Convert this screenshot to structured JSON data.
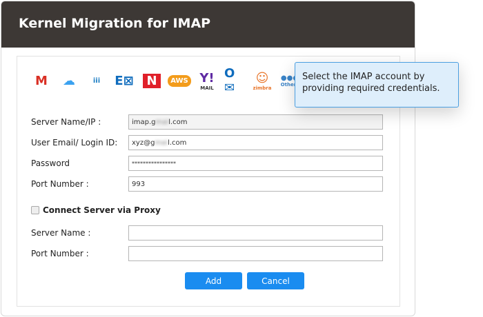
{
  "title": "Kernel Migration for IMAP",
  "providers": [
    {
      "name": "gmail-icon",
      "label": "M",
      "color": "#d93025"
    },
    {
      "name": "icloud-icon",
      "label": "☁",
      "color": "#3ba2f0"
    },
    {
      "name": "lotus-icon",
      "label": "iii",
      "color": "#1f7fc4"
    },
    {
      "name": "exchange-icon",
      "label": "E⊠",
      "color": "#0f6cbd"
    },
    {
      "name": "netmail-icon",
      "label": "N",
      "color": "#e0202a"
    },
    {
      "name": "aws-icon",
      "label": "AWS",
      "color": "#f39c1b"
    },
    {
      "name": "yahoo-icon",
      "label": "Y!",
      "sub": "MAIL",
      "color": "#5f2aa3"
    },
    {
      "name": "outlook-icon",
      "label": "O✉",
      "color": "#0f6cbd"
    },
    {
      "name": "zimbra-icon",
      "label": "☺",
      "sub": "zimbra",
      "color": "#e8752a"
    },
    {
      "name": "others-icon",
      "label": "●●●",
      "sub": "Others",
      "color": "#3a84c8"
    }
  ],
  "form": {
    "server_label": "Server Name/IP :",
    "server_pre": "imap.g",
    "server_blur": "mai",
    "server_post": "l.com",
    "email_label": "User Email/ Login ID:",
    "email_pre": "xyz@g",
    "email_blur": "mai",
    "email_post": "l.com",
    "password_label": "Password",
    "password_value": "****************",
    "port_label": "Port Number :",
    "port_value": "993",
    "proxy_label": "Connect Server via Proxy",
    "proxy_server_label": "Server Name :",
    "proxy_server_value": "",
    "proxy_port_label": "Port Number :",
    "proxy_port_value": ""
  },
  "buttons": {
    "add": "Add",
    "cancel": "Cancel"
  },
  "tooltip": "Select the IMAP account by providing required credentials."
}
